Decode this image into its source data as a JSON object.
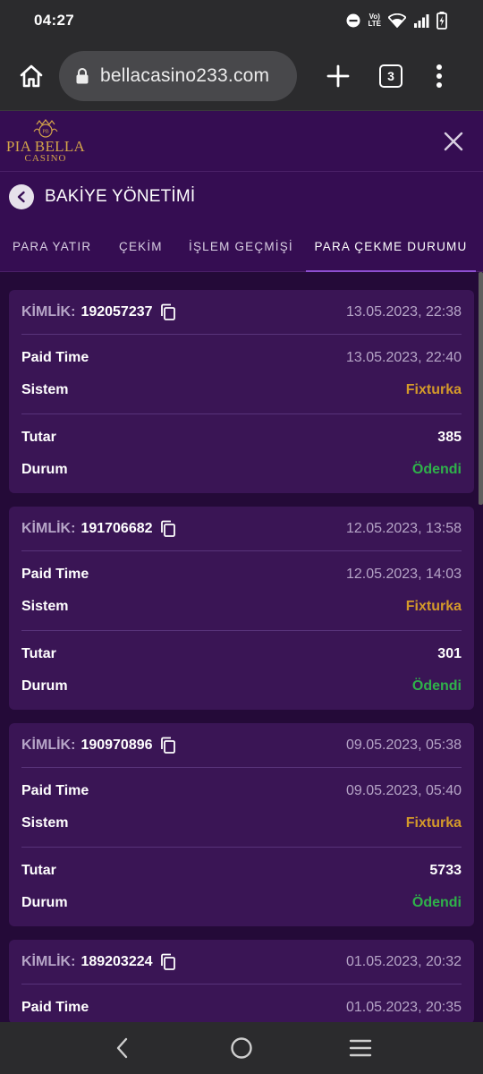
{
  "status": {
    "time": "04:27",
    "net_top": "Vo)",
    "net_bottom": "LTE"
  },
  "browser": {
    "url": "bellacasino233.com",
    "tab_count": "3"
  },
  "site": {
    "logo_line1": "PIA BELLA",
    "logo_line2": "CASINO",
    "logo_badge": "PB"
  },
  "page": {
    "title": "BAKİYE YÖNETİMİ"
  },
  "tabs": [
    {
      "label": "PARA YATIR"
    },
    {
      "label": "ÇEKİM"
    },
    {
      "label": "İŞLEM GEÇMİŞİ"
    },
    {
      "label": "PARA ÇEKME DURUMU"
    }
  ],
  "labels": {
    "id": "KİMLİK:",
    "paid_time": "Paid Time",
    "system": "Sistem",
    "amount": "Tutar",
    "state": "Durum"
  },
  "records": [
    {
      "id": "192057237",
      "date": "13.05.2023, 22:38",
      "paid_time": "13.05.2023, 22:40",
      "system": "Fixturka",
      "amount": "385",
      "state": "Ödendi"
    },
    {
      "id": "191706682",
      "date": "12.05.2023, 13:58",
      "paid_time": "12.05.2023, 14:03",
      "system": "Fixturka",
      "amount": "301",
      "state": "Ödendi"
    },
    {
      "id": "190970896",
      "date": "09.05.2023, 05:38",
      "paid_time": "09.05.2023, 05:40",
      "system": "Fixturka",
      "amount": "5733",
      "state": "Ödendi"
    },
    {
      "id": "189203224",
      "date": "01.05.2023, 20:32",
      "paid_time": "01.05.2023, 20:35"
    }
  ],
  "colors": {
    "accent": "#8e4fd0",
    "gold": "#d2a34a",
    "system": "#d49a2a",
    "paid": "#2fb24a",
    "card": "#3a1555",
    "header": "#350d52"
  }
}
